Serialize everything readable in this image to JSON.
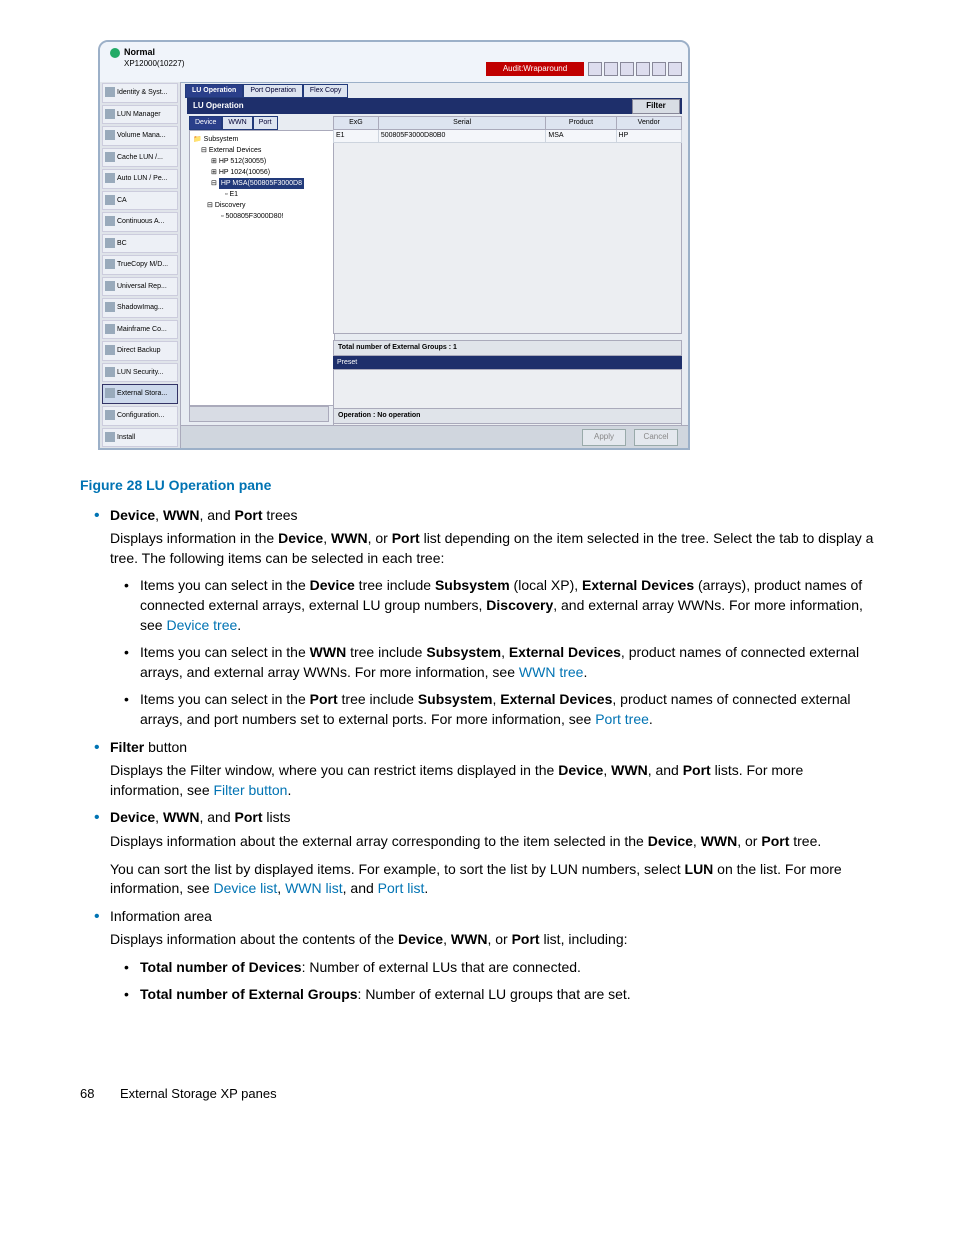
{
  "screenshot": {
    "status_label": "Normal",
    "subtitle": "XP12000(10227)",
    "audit_label": "Audit:Wraparound",
    "sidebar": [
      "Identity & Syst...",
      "LUN Manager",
      "Volume Mana...",
      "Cache LUN /...",
      "Auto LUN / Pe...",
      "CA",
      "Continuous A...",
      "BC",
      "TrueCopy M/D...",
      "Universal Rep...",
      "ShadowImag...",
      "Mainframe Co...",
      "Direct Backup",
      "LUN Security...",
      "External Stora...",
      "Configuration...",
      "Install"
    ],
    "sidebar_selected_index": 14,
    "tabs": [
      "LU Operation",
      "Port Operation",
      "Flex Copy"
    ],
    "active_tab": 0,
    "panel_title": "LU Operation",
    "filter_label": "Filter",
    "subtabs": [
      "Device",
      "WWN",
      "Port"
    ],
    "active_subtab": 0,
    "tree": {
      "root": "Subsystem",
      "ext_devices_label": "External Devices",
      "items": [
        "HP 512(30055)",
        "HP 1024(10056)"
      ],
      "selected": "HP MSA(500805F3000D8",
      "selected_child": "E1",
      "discovery_label": "Discovery",
      "discovery_child": "500805F3000D80!"
    },
    "table": {
      "headers": [
        "ExG",
        "Serial",
        "Product",
        "Vendor"
      ],
      "row": [
        "E1",
        "500805F3000D80B0",
        "MSA",
        "HP"
      ]
    },
    "info_line": "Total number of External Groups : 1",
    "preset_label": "Preset",
    "operation_line": "Operation : No operation",
    "apply_label": "Apply",
    "cancel_label": "Cancel"
  },
  "doc": {
    "fig_caption": "Figure 28 LU Operation pane",
    "li1_lead": "Device, WWN, and Port trees",
    "li1_p1_a": "Displays information in the ",
    "li1_p1_b": ", or ",
    "li1_p1_c": " list depending on the item selected in the tree. Select the tab to display a tree. The following items can be selected in each tree:",
    "dev": "Device",
    "wwn": "WWN",
    "port": "Port",
    "comma_sp": ", ",
    "sub1_a": "Items you can select in the ",
    "sub1_b": " tree include ",
    "subsystem": "Subsystem",
    "sub1_c": " (local XP), ",
    "ext_devices": "External Devices",
    "sub1_d": " (arrays), product names of connected external arrays, external LU group numbers, ",
    "discovery": "Discovery",
    "sub1_e": ", and external array WWNs. For more information, see ",
    "link_device_tree": "Device tree",
    "period": ".",
    "sub2_a": "Items you can select in the ",
    "sub2_b": " tree include ",
    "sub2_c": ", product names of connected external arrays, and external array WWNs. For more information, see ",
    "link_wwn_tree": "WWN tree",
    "sub3_a": "Items you can select in the ",
    "sub3_b": " tree include ",
    "sub3_c": ", product names of connected external arrays, and port numbers set to external ports. For more information, see ",
    "link_port_tree": "Port tree",
    "li2_lead": "Filter",
    "li2_lead_suffix": " button",
    "li2_p_a": "Displays the Filter window, where you can restrict items displayed in the ",
    "li2_p_b": ", and ",
    "li2_p_c": " lists. For more information, see ",
    "link_filter_button": "Filter button",
    "li3_lead_suffix": " lists",
    "li3_p1_a": "Displays information about the external array corresponding to the item selected in the ",
    "li3_p1_b": ", or ",
    "li3_p1_c": " tree.",
    "li3_p2_a": "You can sort the list by displayed items. For example, to sort the list by LUN numbers, select ",
    "lun": "LUN",
    "li3_p2_b": " on the list. For more information, see ",
    "link_device_list": "Device list",
    "link_wwn_list": "WWN list",
    "and_sp": ", and ",
    "link_port_list": "Port list",
    "li4_lead": "Information area",
    "li4_p1_a": "Displays information about the contents of the ",
    "li4_p1_b": ", or ",
    "li4_p1_c": " list, including:",
    "li4_s1_b": "Total number of Devices",
    "li4_s1_t": ": Number of external LUs that are connected.",
    "li4_s2_b": "Total number of External Groups",
    "li4_s2_t": ": Number of external LU groups that are set.",
    "page_num": "68",
    "footer_text": "External Storage XP panes"
  }
}
